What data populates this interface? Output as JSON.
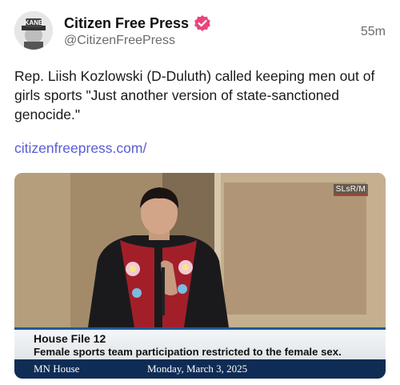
{
  "post": {
    "author_name": "Citizen Free Press",
    "author_handle": "@CitizenFreePress",
    "timestamp": "55m",
    "avatar_text": "KANE",
    "verified_icon": "verified-badge-icon",
    "text": "Rep. Liish Kozlowski (D-Duluth) called keeping men out of girls sports \"Just another version of state-sanctioned genocide.\"",
    "link_text": "citizenfreepress.com/"
  },
  "media": {
    "broadcaster_bug": "SLsR/M",
    "bill_title": "House File 12",
    "bill_description": "Female sports team participation restricted to the female sex.",
    "network_name": "MN House",
    "date": "Monday, March 3, 2025"
  },
  "colors": {
    "link": "#5b5bd6",
    "verified": "#e8457a",
    "chyron_accent": "#1f5a9a",
    "chyron_bar": "#0f2c55"
  }
}
